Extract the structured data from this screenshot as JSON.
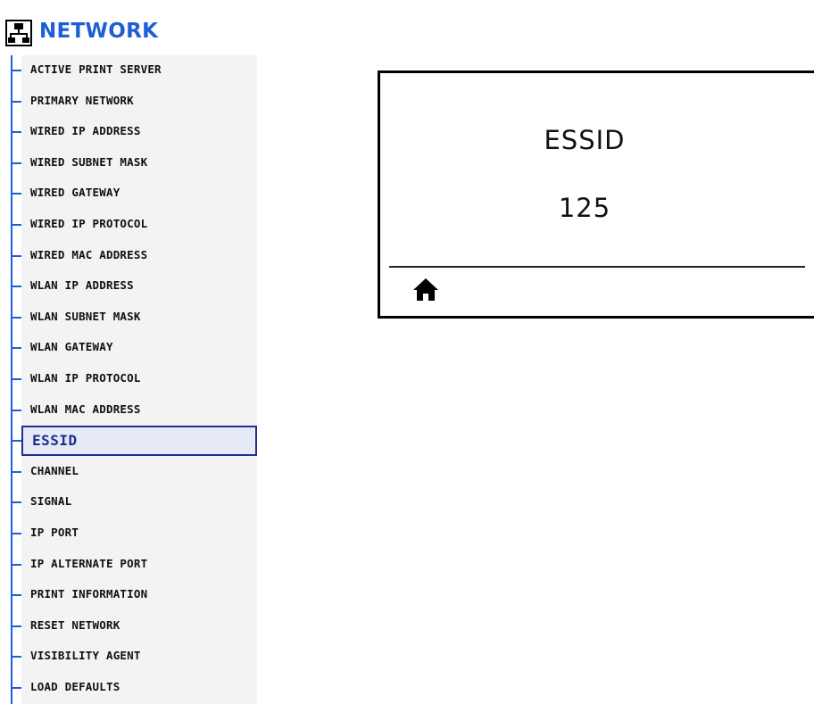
{
  "header": {
    "title": "NETWORK",
    "icon": "network-icon",
    "accent_color": "#1e5fd6"
  },
  "menu": {
    "selected_index": 12,
    "items": [
      {
        "label": "ACTIVE PRINT SERVER"
      },
      {
        "label": "PRIMARY NETWORK"
      },
      {
        "label": "WIRED IP ADDRESS"
      },
      {
        "label": "WIRED SUBNET MASK"
      },
      {
        "label": "WIRED GATEWAY"
      },
      {
        "label": "WIRED IP PROTOCOL"
      },
      {
        "label": "WIRED MAC ADDRESS"
      },
      {
        "label": "WLAN IP ADDRESS"
      },
      {
        "label": "WLAN SUBNET MASK"
      },
      {
        "label": "WLAN GATEWAY"
      },
      {
        "label": "WLAN IP PROTOCOL"
      },
      {
        "label": "WLAN MAC ADDRESS"
      },
      {
        "label": "ESSID"
      },
      {
        "label": "CHANNEL"
      },
      {
        "label": "SIGNAL"
      },
      {
        "label": "IP PORT"
      },
      {
        "label": "IP ALTERNATE PORT"
      },
      {
        "label": "PRINT INFORMATION"
      },
      {
        "label": "RESET NETWORK"
      },
      {
        "label": "VISIBILITY AGENT"
      },
      {
        "label": "LOAD DEFAULTS"
      }
    ]
  },
  "display": {
    "title": "ESSID",
    "value": "125",
    "home_icon": "home-icon"
  }
}
